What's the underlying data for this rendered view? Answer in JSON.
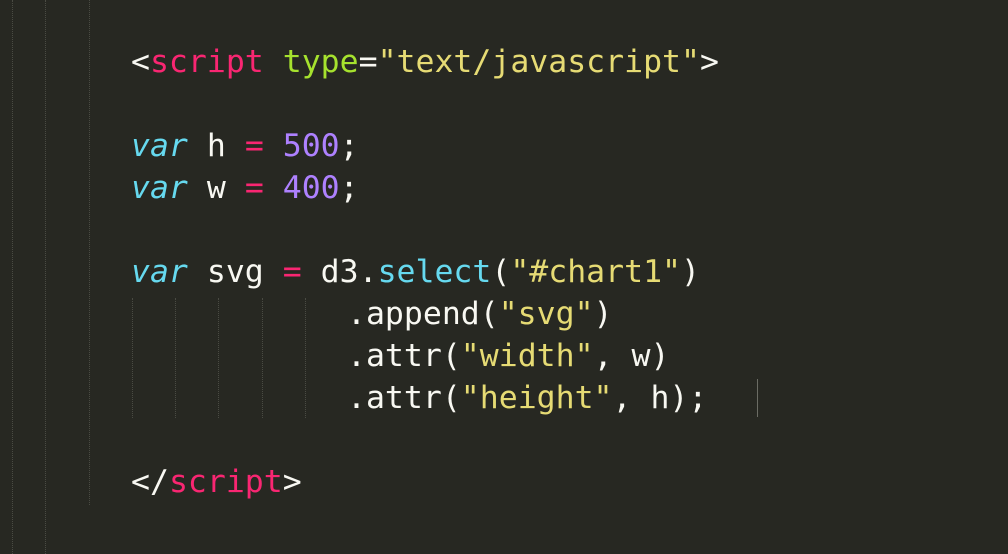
{
  "editor": {
    "lines": [
      {
        "id": "l1",
        "tokens": [
          {
            "t": "<",
            "c": "plain"
          },
          {
            "t": "script",
            "c": "kw-tag"
          },
          {
            "t": " ",
            "c": "plain"
          },
          {
            "t": "type",
            "c": "attr"
          },
          {
            "t": "=",
            "c": "plain"
          },
          {
            "t": "\"text/javascript\"",
            "c": "str"
          },
          {
            "t": ">",
            "c": "plain"
          }
        ]
      },
      {
        "id": "l2",
        "tokens": [
          {
            "t": "var",
            "c": "storage"
          },
          {
            "t": " h ",
            "c": "plain"
          },
          {
            "t": "=",
            "c": "op"
          },
          {
            "t": " ",
            "c": "plain"
          },
          {
            "t": "500",
            "c": "num"
          },
          {
            "t": ";",
            "c": "plain"
          }
        ]
      },
      {
        "id": "l3",
        "tokens": [
          {
            "t": "var",
            "c": "storage"
          },
          {
            "t": " w ",
            "c": "plain"
          },
          {
            "t": "=",
            "c": "op"
          },
          {
            "t": " ",
            "c": "plain"
          },
          {
            "t": "400",
            "c": "num"
          },
          {
            "t": ";",
            "c": "plain"
          }
        ]
      },
      {
        "id": "l4",
        "tokens": [
          {
            "t": "var",
            "c": "storage"
          },
          {
            "t": " svg ",
            "c": "plain"
          },
          {
            "t": "=",
            "c": "op"
          },
          {
            "t": " d3.",
            "c": "plain"
          },
          {
            "t": "select",
            "c": "fn"
          },
          {
            "t": "(",
            "c": "plain"
          },
          {
            "t": "\"#chart1\"",
            "c": "str"
          },
          {
            "t": ")",
            "c": "plain"
          }
        ]
      },
      {
        "id": "l5",
        "tokens": [
          {
            "t": ".append(",
            "c": "plain"
          },
          {
            "t": "\"svg\"",
            "c": "str"
          },
          {
            "t": ")",
            "c": "plain"
          }
        ]
      },
      {
        "id": "l6",
        "tokens": [
          {
            "t": ".attr(",
            "c": "plain"
          },
          {
            "t": "\"width\"",
            "c": "str"
          },
          {
            "t": ", w)",
            "c": "plain"
          }
        ]
      },
      {
        "id": "l7",
        "tokens": [
          {
            "t": ".attr(",
            "c": "plain"
          },
          {
            "t": "\"height\"",
            "c": "str"
          },
          {
            "t": ", h);",
            "c": "plain"
          }
        ]
      },
      {
        "id": "l8",
        "tokens": [
          {
            "t": "</",
            "c": "plain"
          },
          {
            "t": "script",
            "c": "kw-tag"
          },
          {
            "t": ">",
            "c": "plain"
          }
        ]
      }
    ]
  },
  "colors": {
    "background": "#272822",
    "tag": "#f92672",
    "attribute": "#a6e22e",
    "string": "#e6db74",
    "storage": "#66d9ef",
    "number": "#ae81ff",
    "text": "#f8f8f2"
  }
}
